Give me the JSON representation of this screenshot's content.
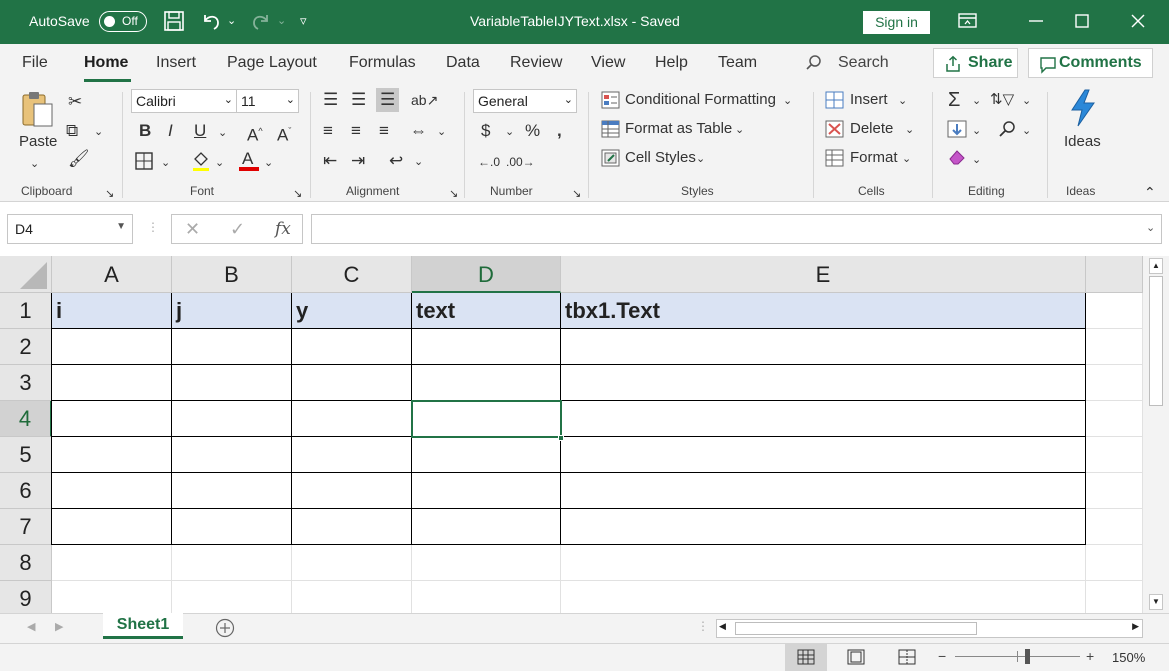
{
  "titlebar": {
    "autosave_label": "AutoSave",
    "autosave_state": "Off",
    "document_title": "VariableTableIJYText.xlsx  -  Saved",
    "signin_label": "Sign in"
  },
  "tabs": [
    "File",
    "Home",
    "Insert",
    "Page Layout",
    "Formulas",
    "Data",
    "Review",
    "View",
    "Help",
    "Team"
  ],
  "active_tab": "Home",
  "search_label": "Search",
  "share_label": "Share",
  "comments_label": "Comments",
  "ribbon": {
    "clipboard": {
      "paste_label": "Paste",
      "group_label": "Clipboard"
    },
    "font": {
      "font_name": "Calibri",
      "font_size": "11",
      "group_label": "Font"
    },
    "alignment": {
      "group_label": "Alignment"
    },
    "number": {
      "format": "General",
      "group_label": "Number"
    },
    "styles": {
      "conditional_formatting": "Conditional Formatting",
      "format_as_table": "Format as Table",
      "cell_styles": "Cell Styles",
      "group_label": "Styles"
    },
    "cells": {
      "insert": "Insert",
      "delete": "Delete",
      "format": "Format",
      "group_label": "Cells"
    },
    "editing": {
      "group_label": "Editing"
    },
    "ideas": {
      "label": "Ideas",
      "group_label": "Ideas"
    }
  },
  "formula_bar": {
    "name_box": "D4",
    "fx_label": "fx",
    "formula_value": ""
  },
  "sheet": {
    "columns": [
      "A",
      "B",
      "C",
      "D",
      "E"
    ],
    "rows": [
      "1",
      "2",
      "3",
      "4",
      "5",
      "6",
      "7",
      "8",
      "9"
    ],
    "selected_cell": "D4",
    "header_row": [
      "i",
      "j",
      "y",
      "text",
      "tbx1.Text"
    ]
  },
  "sheet_tab": "Sheet1",
  "zoom": "150%",
  "colors": {
    "accent": "#217346",
    "header_fill": "#dae3f3"
  }
}
